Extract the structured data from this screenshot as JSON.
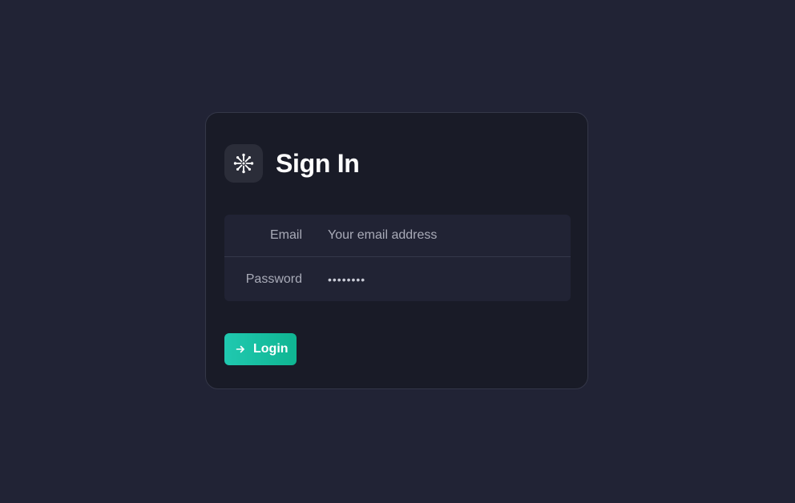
{
  "form": {
    "title": "Sign In",
    "logo_icon": "asterisk-burst-icon",
    "email_label": "Email",
    "email_placeholder": "Your email address",
    "email_value": "",
    "password_label": "Password",
    "password_value": "••••••••",
    "login_label": "Login",
    "login_icon": "arrow-right-icon"
  },
  "colors": {
    "background": "#212335",
    "card": "#191b27",
    "accent": "#20c9b0"
  }
}
